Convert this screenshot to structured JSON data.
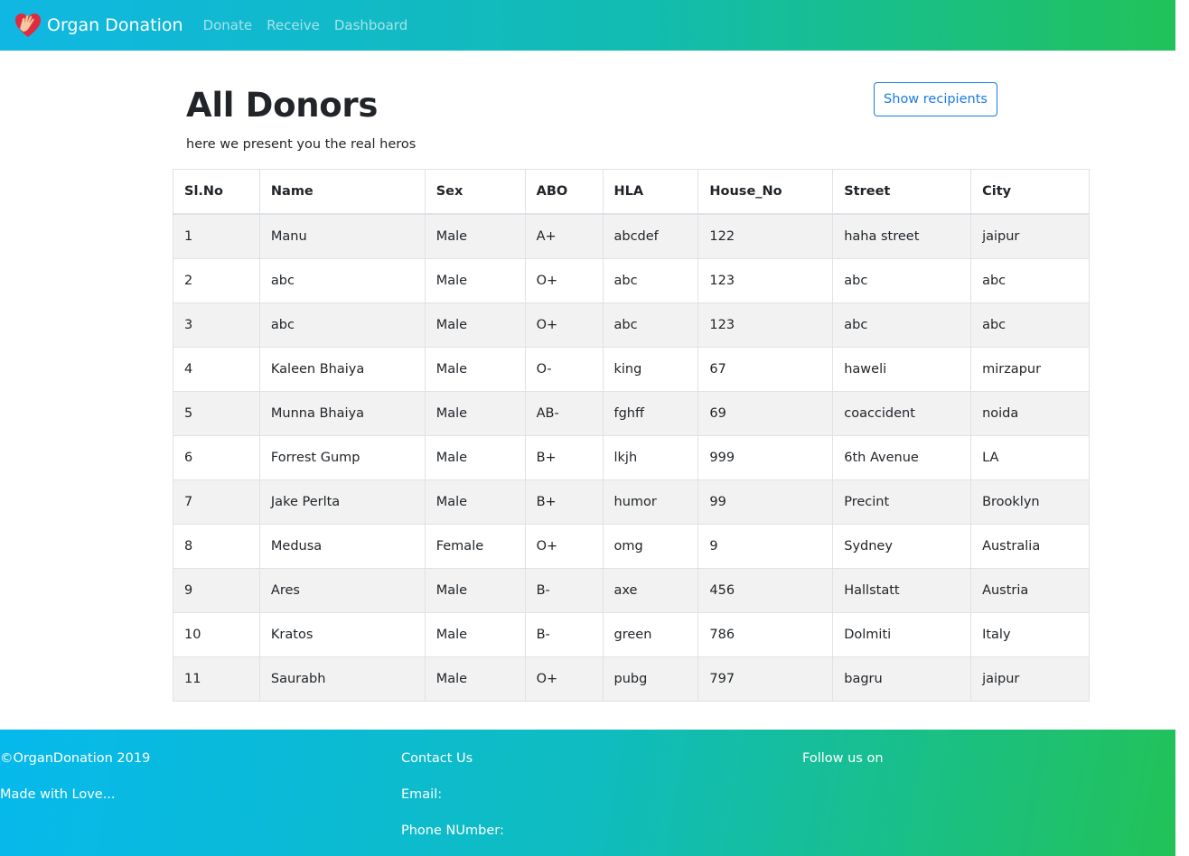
{
  "nav": {
    "brand": "Organ Donation",
    "links": [
      "Donate",
      "Receive",
      "Dashboard"
    ]
  },
  "main": {
    "title": "All Donors",
    "subtitle": "here we present you the real heros",
    "show_button": "Show recipients"
  },
  "table": {
    "headers": [
      "Sl.No",
      "Name",
      "Sex",
      "ABO",
      "HLA",
      "House_No",
      "Street",
      "City"
    ],
    "rows": [
      [
        "1",
        "Manu",
        "Male",
        "A+",
        "abcdef",
        "122",
        "haha street",
        "jaipur"
      ],
      [
        "2",
        "abc",
        "Male",
        "O+",
        "abc",
        "123",
        "abc",
        "abc"
      ],
      [
        "3",
        "abc",
        "Male",
        "O+",
        "abc",
        "123",
        "abc",
        "abc"
      ],
      [
        "4",
        "Kaleen Bhaiya",
        "Male",
        "O-",
        "king",
        "67",
        "haweli",
        "mirzapur"
      ],
      [
        "5",
        "Munna Bhaiya",
        "Male",
        "AB-",
        "fghff",
        "69",
        "coaccident",
        "noida"
      ],
      [
        "6",
        "Forrest Gump",
        "Male",
        "B+",
        "lkjh",
        "999",
        "6th Avenue",
        "LA"
      ],
      [
        "7",
        "Jake Perlta",
        "Male",
        "B+",
        "humor",
        "99",
        "Precint",
        "Brooklyn"
      ],
      [
        "8",
        "Medusa",
        "Female",
        "O+",
        "omg",
        "9",
        "Sydney",
        "Australia"
      ],
      [
        "9",
        "Ares",
        "Male",
        "B-",
        "axe",
        "456",
        "Hallstatt",
        "Austria"
      ],
      [
        "10",
        "Kratos",
        "Male",
        "B-",
        "green",
        "786",
        "Dolmiti",
        "Italy"
      ],
      [
        "11",
        "Saurabh",
        "Male",
        "O+",
        "pubg",
        "797",
        "bagru",
        "jaipur"
      ]
    ]
  },
  "footer": {
    "copyright": "©OrganDonation 2019",
    "made_with": "Made with Love...",
    "contact": "Contact Us",
    "email": "Email:",
    "phone": "Phone NUmber:",
    "follow": "Follow us on"
  },
  "colors": {
    "accent": "#1a7be6",
    "gradient_start": "#10b7e3",
    "gradient_end": "#21c25a",
    "row_stripe": "#f2f2f2"
  },
  "icons": {
    "brand": "heart-hand-icon"
  }
}
